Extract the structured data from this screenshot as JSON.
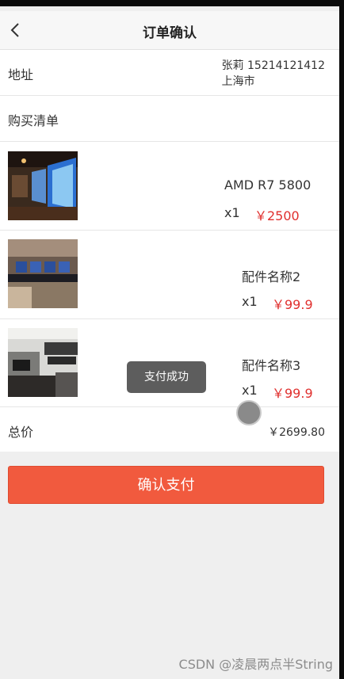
{
  "header": {
    "title": "订单确认",
    "back_icon": "chevron-left-icon"
  },
  "address": {
    "label": "地址",
    "line1": "张莉 15214121412",
    "line2": "上海市"
  },
  "shopping_list": {
    "label": "购买清单"
  },
  "items": [
    {
      "name": "AMD R7 5800",
      "qty": "x1",
      "price": "￥2500"
    },
    {
      "name": "配件名称2",
      "qty": "x1",
      "price": "￥99.9"
    },
    {
      "name": "配件名称3",
      "qty": "x1",
      "price": "￥99.9"
    }
  ],
  "total": {
    "label": "总价",
    "value": "￥2699.80"
  },
  "pay_button": {
    "label": "确认支付"
  },
  "toast": {
    "text": "支付成功"
  },
  "watermark": {
    "text": "CSDN @凌晨两点半String"
  },
  "colors": {
    "accent": "#f15a3e",
    "price": "#e0302e"
  }
}
